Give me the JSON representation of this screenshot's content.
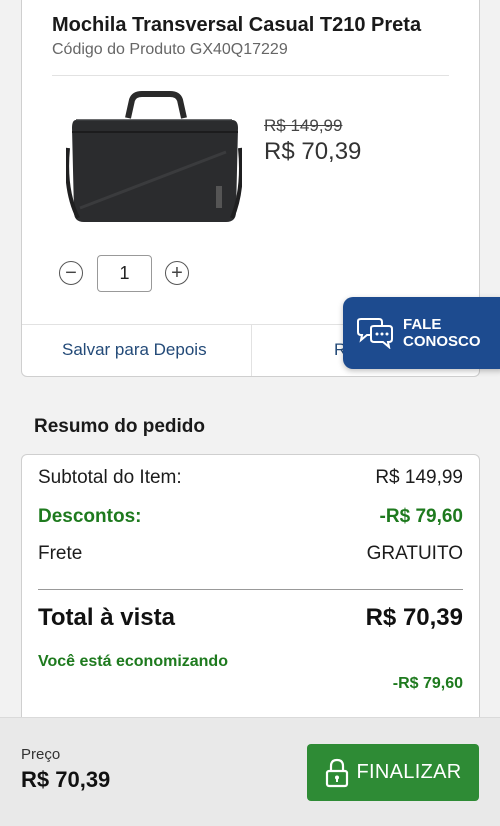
{
  "product": {
    "title": "Mochila Transversal Casual T210 Preta",
    "code": "Código do Produto GX40Q17229",
    "old_price": "R$ 149,99",
    "new_price": "R$ 70,39",
    "quantity": "1",
    "save_later": "Salvar para Depois",
    "remove_partial": "R"
  },
  "chat": {
    "line1": "FALE",
    "line2": "CONOSCO"
  },
  "summary": {
    "title": "Resumo do pedido",
    "subtotal_label": "Subtotal do Item:",
    "subtotal_value": "R$ 149,99",
    "discount_label": "Descontos:",
    "discount_value": "-R$ 79,60",
    "shipping_label": "Frete",
    "shipping_value": "GRATUITO",
    "total_label": "Total à vista",
    "total_value": "R$ 70,39",
    "saving_label": "Você está economizando",
    "saving_value": "-R$ 79,60"
  },
  "footer": {
    "price_label": "Preço",
    "price_value": "R$ 70,39",
    "checkout_label": "FINALIZAR"
  },
  "icons": {
    "chat": "chat-bubbles-icon",
    "lock": "lock-icon",
    "minus": "minus-icon",
    "plus": "plus-icon"
  },
  "colors": {
    "brand_blue": "#1d4b8f",
    "link_blue": "#234a78",
    "discount_green": "#1e7a1e",
    "checkout_green": "#2e8b35"
  }
}
